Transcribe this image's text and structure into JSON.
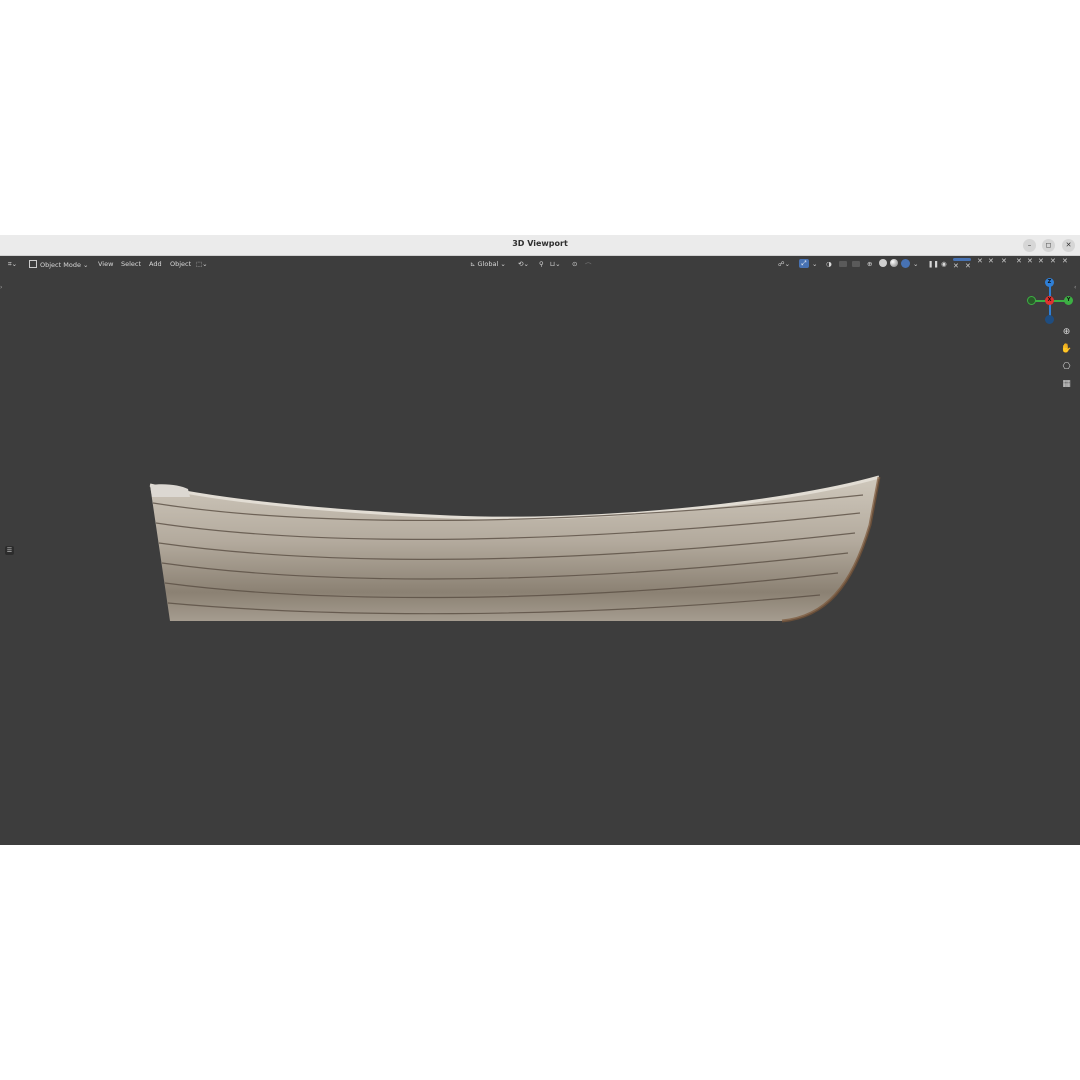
{
  "window": {
    "title": "3D Viewport",
    "minimize": "–",
    "maximize": "◻",
    "close": "✕"
  },
  "header": {
    "editor_icon": "⌗",
    "mode_label": "Object Mode",
    "menus": [
      "View",
      "Select",
      "Add",
      "Object"
    ],
    "orientation_label": "Global",
    "caret": "⌄"
  },
  "gizmo": {
    "axes": [
      "Z",
      "Y",
      "X"
    ]
  },
  "icons": {
    "zoom": "magnifier-icon",
    "pan": "hand-icon",
    "camera": "camera-icon",
    "grid": "grid-icon"
  },
  "colors": {
    "viewport_bg": "#3d3d3d",
    "axis_x": "#e0332f",
    "axis_y": "#3cb043",
    "axis_z": "#2f7fd6",
    "accent": "#4772b3"
  }
}
